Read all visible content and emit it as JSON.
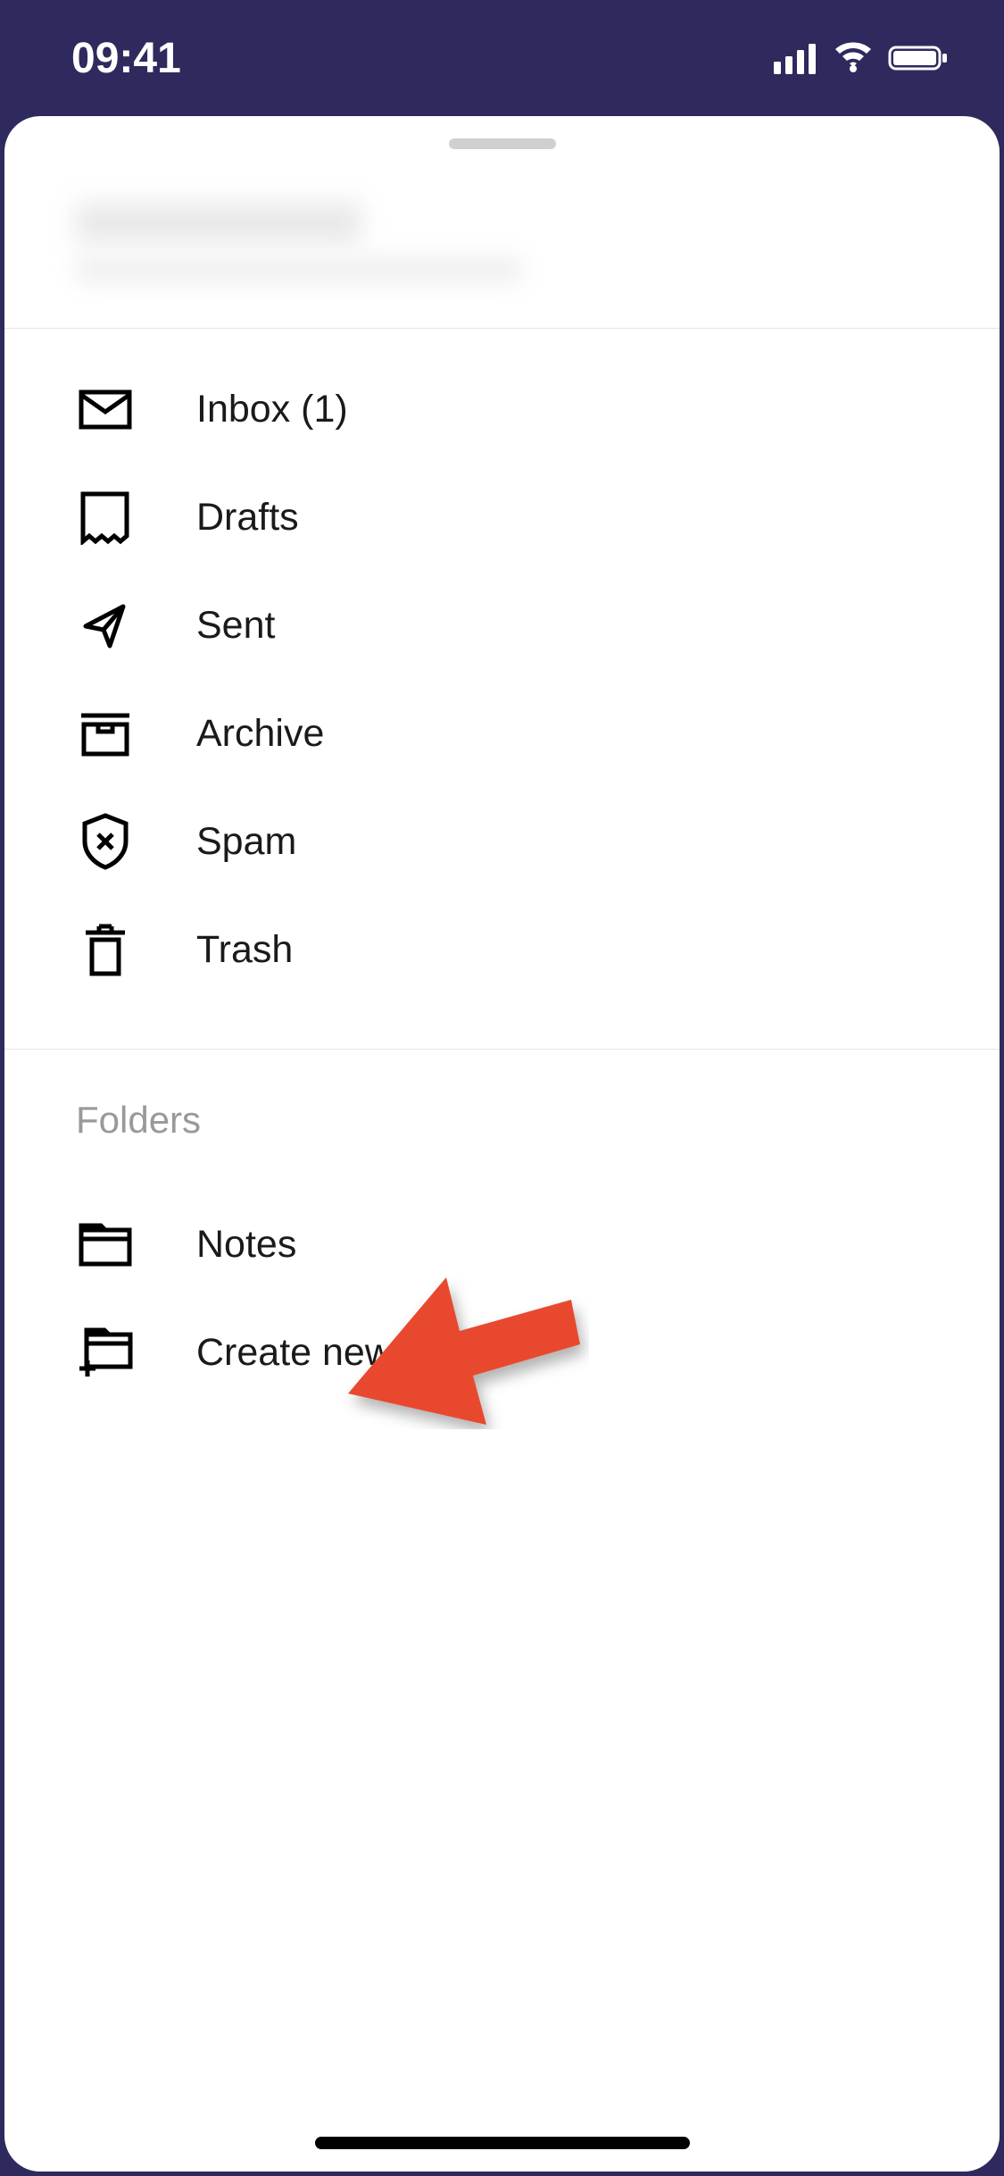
{
  "status_bar": {
    "time": "09:41"
  },
  "menu": {
    "items": [
      {
        "label": "Inbox (1)",
        "icon": "envelope-icon"
      },
      {
        "label": "Drafts",
        "icon": "drafts-icon"
      },
      {
        "label": "Sent",
        "icon": "sent-icon"
      },
      {
        "label": "Archive",
        "icon": "archive-icon"
      },
      {
        "label": "Spam",
        "icon": "spam-icon"
      },
      {
        "label": "Trash",
        "icon": "trash-icon"
      }
    ]
  },
  "folders": {
    "header": "Folders",
    "items": [
      {
        "label": "Notes",
        "icon": "folder-icon"
      },
      {
        "label": "Create new folder",
        "icon": "folder-add-icon"
      }
    ]
  }
}
